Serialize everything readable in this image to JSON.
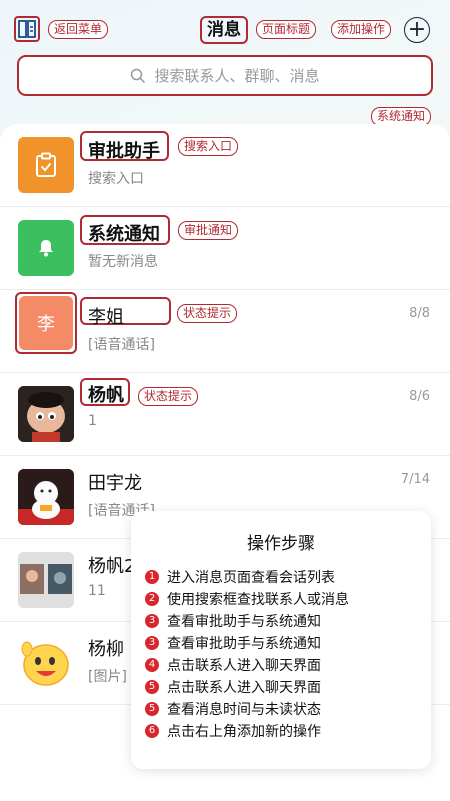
{
  "header": {
    "title": "消息",
    "menu_icon": "contacts-book-icon",
    "add_icon": "plus-circle-icon"
  },
  "search": {
    "placeholder": "搜索联系人、群聊、消息"
  },
  "annotations": {
    "back_menu": "返回菜单",
    "page_title": "页面标题",
    "add_action": "添加操作",
    "system_notice": "系统通知",
    "search_entry": "搜索入口",
    "approval_notice": "审批通知",
    "status_hint_1": "状态提示",
    "status_hint_2": "状态提示"
  },
  "conversations": [
    {
      "name": "审批助手",
      "subtitle": "搜索入口",
      "time": "",
      "avatar_icon": "clipboard-check-icon",
      "avatar_color": "#f0932a"
    },
    {
      "name": "系统通知",
      "subtitle": "暂无新消息",
      "time": "",
      "avatar_icon": "bell-icon",
      "avatar_color": "#3cbf5f"
    },
    {
      "name": "李姐",
      "subtitle": "[语音通话]",
      "time": "8/8",
      "avatar_text": "李",
      "avatar_color": "#f58a66"
    },
    {
      "name": "杨帆",
      "subtitle": "1",
      "time": "8/6",
      "avatar_icon": "cartoon-character-photo"
    },
    {
      "name": "田宇龙",
      "subtitle": "[语音通话]",
      "time": "7/14",
      "avatar_icon": "lucky-cat-photo"
    },
    {
      "name": "杨帆2",
      "subtitle": "11",
      "time": "",
      "avatar_icon": "group-photo"
    },
    {
      "name": "杨柳",
      "subtitle": "[图片]",
      "time": "",
      "avatar_icon": "cartoon-sticker"
    }
  ],
  "steps_panel": {
    "title": "操作步骤",
    "steps": [
      {
        "num": "1",
        "text": "进入消息页面查看会话列表"
      },
      {
        "num": "2",
        "text": "使用搜索框查找联系人或消息"
      },
      {
        "num": "3",
        "text": "查看审批助手与系统通知"
      },
      {
        "num": "3",
        "text": "查看审批助手与系统通知"
      },
      {
        "num": "4",
        "text": "点击联系人进入聊天界面"
      },
      {
        "num": "5",
        "text": "点击联系人进入聊天界面"
      },
      {
        "num": "5",
        "text": "查看消息时间与未读状态"
      },
      {
        "num": "6",
        "text": "点击右上角添加新的操作"
      }
    ]
  }
}
